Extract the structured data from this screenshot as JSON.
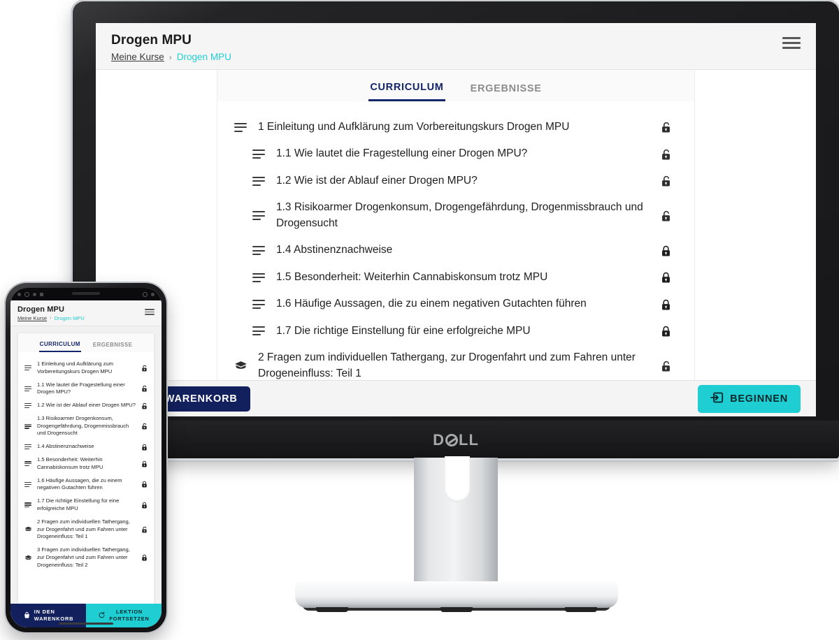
{
  "app": {
    "title": "Drogen MPU",
    "breadcrumb": {
      "parent": "Meine Kurse",
      "separator": "›",
      "current": "Drogen MPU"
    },
    "menu_icon": "hamburger-menu-icon",
    "tabs": [
      {
        "label": "CURRICULUM",
        "active": true
      },
      {
        "label": "ERGEBNISSE",
        "active": false
      }
    ],
    "curriculum": [
      {
        "title": "1 Einleitung und Aufklärung zum Vorbereitungskurs Drogen MPU",
        "level": "section",
        "icon": "list-icon",
        "lock": "unlocked-icon"
      },
      {
        "title": "1.1 Wie lautet die Fragestellung einer Drogen MPU?",
        "level": "lesson",
        "icon": "list-icon",
        "lock": "unlocked-icon"
      },
      {
        "title": "1.2 Wie ist der Ablauf einer Drogen MPU?",
        "level": "lesson",
        "icon": "list-icon",
        "lock": "unlocked-icon"
      },
      {
        "title": "1.3 Risikoarmer Drogenkonsum, Drogengefährdung, Drogenmissbrauch und Drogensucht",
        "level": "lesson",
        "icon": "list-icon",
        "lock": "unlocked-icon"
      },
      {
        "title": "1.4 Abstinenznachweise",
        "level": "lesson",
        "icon": "list-icon",
        "lock": "locked-icon"
      },
      {
        "title": "1.5 Besonderheit: Weiterhin Cannabiskonsum trotz MPU",
        "level": "lesson",
        "icon": "list-icon",
        "lock": "locked-icon"
      },
      {
        "title": "1.6 Häufige Aussagen, die zu einem negativen Gutachten führen",
        "level": "lesson",
        "icon": "list-icon",
        "lock": "locked-icon"
      },
      {
        "title": "1.7 Die richtige Einstellung für eine erfolgreiche MPU",
        "level": "lesson",
        "icon": "list-icon",
        "lock": "locked-icon"
      },
      {
        "title": "2 Fragen zum individuellen Tathergang, zur Drogenfahrt und zum Fahren unter Drogeneinfluss: Teil 1",
        "level": "section",
        "icon": "graduation-cap-icon",
        "lock": "unlocked-icon"
      },
      {
        "title": "3 Fragen zum individuellen Tathergang, zur Drogenfahrt und zum Fahren unter Drogeneinfluss: Teil 2",
        "level": "section",
        "icon": "graduation-cap-icon",
        "lock": "locked-icon"
      }
    ],
    "footer": {
      "cart_button": "WARENKORB",
      "cart_button_full": "IN DEN WARENKORB",
      "cart_button_line1": "IN DEN",
      "cart_button_line2": "WARENKORB",
      "cart_icon": "shopping-basket-icon",
      "start_button": "BEGINNEN",
      "start_icon": "login-arrow-icon",
      "continue_button_line1": "LEKTION",
      "continue_button_line2": "FORTSETZEN",
      "continue_icon": "refresh-icon"
    }
  },
  "devices": {
    "monitor_brand": "D",
    "monitor_brand_tail": "LL"
  },
  "colors": {
    "accent_teal": "#1fced2",
    "navy": "#12205e",
    "tab_active": "#13256b",
    "header_bg": "#f5f5f5",
    "text": "#1f1f1f"
  }
}
